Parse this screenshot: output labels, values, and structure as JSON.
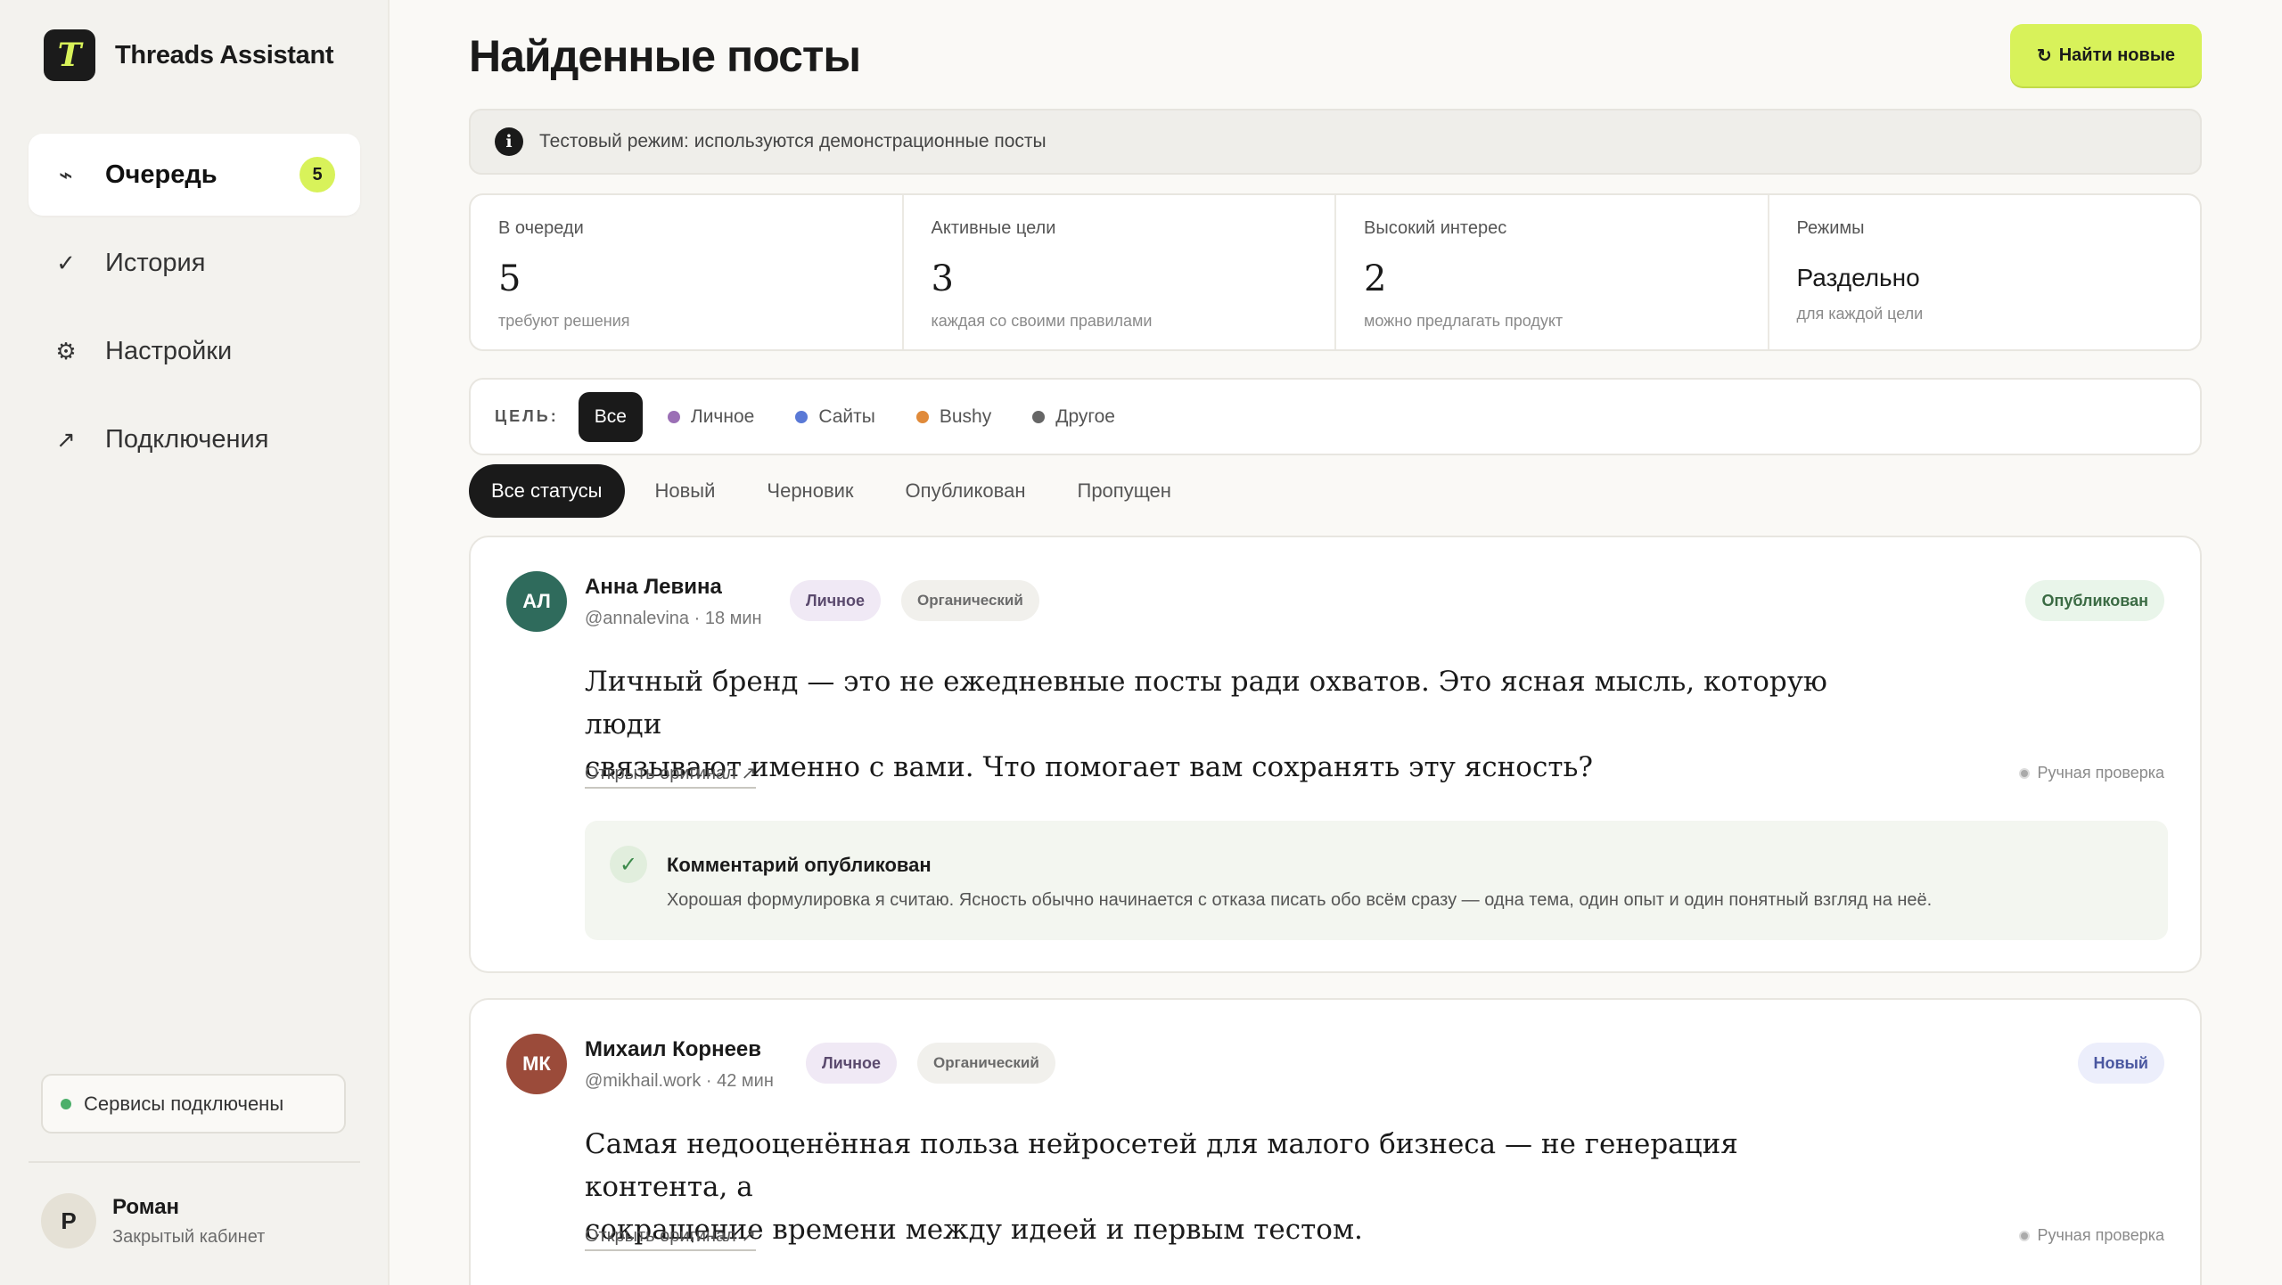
{
  "app": {
    "logo_letter": "T",
    "name": "Threads Assistant"
  },
  "nav": [
    {
      "icon": "pulse-icon",
      "glyph": "⌁",
      "label": "Очередь",
      "badge": "5",
      "active": true
    },
    {
      "icon": "check-icon",
      "glyph": "✓",
      "label": "История"
    },
    {
      "icon": "gear-icon",
      "glyph": "⚙",
      "label": "Настройки"
    },
    {
      "icon": "arrow-up-right-icon",
      "glyph": "↗",
      "label": "Подключения"
    }
  ],
  "services_status": "Сервисы подключены",
  "user": {
    "initial": "Р",
    "name": "Роман",
    "subtitle": "Закрытый кабинет"
  },
  "page": {
    "title": "Найденные посты",
    "find_button": "Найти новые",
    "find_icon": "↻",
    "notice": "Тестовый режим: используются демонстрационные посты"
  },
  "stats": [
    {
      "label": "В очереди",
      "value": "5",
      "sub": "требуют решения"
    },
    {
      "label": "Активные цели",
      "value": "3",
      "sub": "каждая со своими правилами"
    },
    {
      "label": "Высокий интерес",
      "value": "2",
      "sub": "можно предлагать продукт"
    },
    {
      "label": "Режимы",
      "value": "Раздельно",
      "sub": "для каждой цели"
    }
  ],
  "goals": {
    "label": "ЦЕЛЬ:",
    "all": "Все",
    "options": [
      {
        "label": "Личное",
        "color": "#9b6fb5"
      },
      {
        "label": "Сайты",
        "color": "#5a79d6"
      },
      {
        "label": "Bushy",
        "color": "#e08a3a"
      },
      {
        "label": "Другое",
        "color": "#666666"
      }
    ]
  },
  "status_tabs": [
    "Все статусы",
    "Новый",
    "Черновик",
    "Опубликован",
    "Пропущен"
  ],
  "posts": [
    {
      "initials": "АЛ",
      "avatar_color": "#2f6b5c",
      "author": "Анна Левина",
      "handle": "@annalevina · 18 мин",
      "tag": "Личное",
      "type": "Органический",
      "status": "Опубликован",
      "text_line1": "Личный бренд — это не ежедневные посты ради охватов. Это ясная мысль, которую люди",
      "text_line2": "связывают именно с вами. Что помогает вам сохранять эту ясность?",
      "open_link": "Открыть оригинал ↗",
      "review": "Ручная проверка",
      "comment_title": "Комментарий опубликован",
      "comment_text": "Хорошая формулировка я считаю. Ясность обычно начинается с отказа писать обо всём сразу — одна тема, один опыт и один понятный взгляд на неё."
    },
    {
      "initials": "МК",
      "avatar_color": "#9b4b3a",
      "author": "Михаил Корнеев",
      "handle": "@mikhail.work · 42 мин",
      "tag": "Личное",
      "type": "Органический",
      "status": "Новый",
      "text_line1": "Самая недооценённая польза нейросетей для малого бизнеса — не генерация контента, а",
      "text_line2": "сокращение времени между идеей и первым тестом.",
      "open_link": "Открыть оригинал ↗",
      "review": "Ручная проверка"
    }
  ]
}
